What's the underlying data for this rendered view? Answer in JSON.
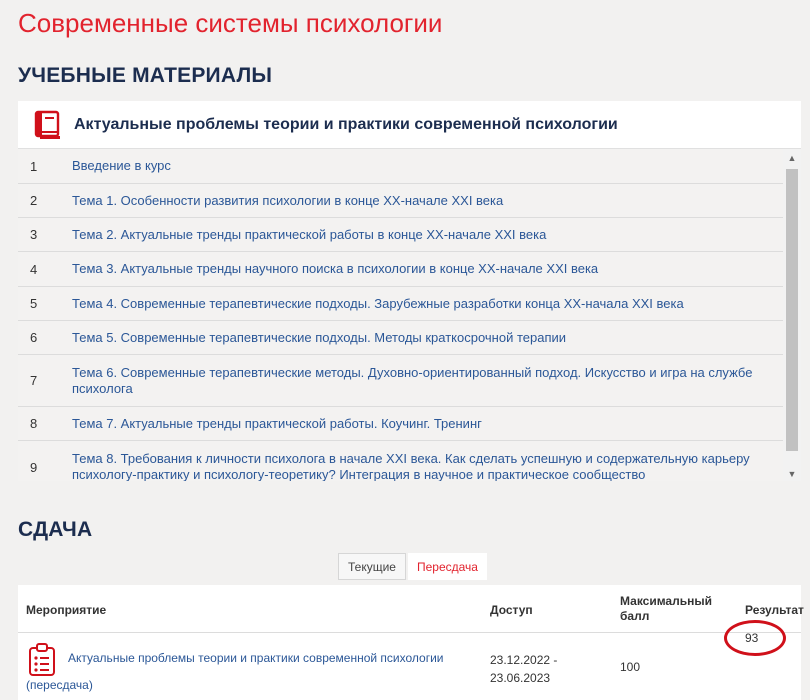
{
  "page": {
    "title": "Современные системы психологии"
  },
  "materials": {
    "heading": "УЧЕБНЫЕ МАТЕРИАЛЫ",
    "course_title": "Актуальные проблемы теории и практики современной психологии",
    "topics": [
      {
        "num": "1",
        "title": "Введение в курс"
      },
      {
        "num": "2",
        "title": "Тема 1. Особенности развития психологии в конце XX-начале XXI века"
      },
      {
        "num": "3",
        "title": "Тема 2. Актуальные тренды практической работы в конце XX-начале XXI века"
      },
      {
        "num": "4",
        "title": "Тема 3. Актуальные тренды научного поиска в психологии в конце XX-начале XXI века"
      },
      {
        "num": "5",
        "title": "Тема 4. Современные терапевтические подходы. Зарубежные разработки конца XX-начала XXI века"
      },
      {
        "num": "6",
        "title": "Тема 5. Современные терапевтические подходы. Методы краткосрочной терапии"
      },
      {
        "num": "7",
        "title": "Тема 6. Современные терапевтические методы. Духовно-ориентированный подход. Искусство и игра на службе психолога"
      },
      {
        "num": "8",
        "title": "Тема 7. Актуальные тренды практической работы. Коучинг. Тренинг"
      },
      {
        "num": "9",
        "title": "Тема 8. Требования к личности психолога в начале XXI века. Как сделать успешную и содержательную карьеру психологу-практику и психологу-теоретику? Интеграция в научное и практическое сообщество"
      }
    ]
  },
  "submission": {
    "heading": "СДАЧА",
    "tabs": {
      "current": "Текущие",
      "retake": "Пересдача"
    },
    "table": {
      "headers": {
        "event": "Мероприятие",
        "access": "Доступ",
        "max_score": "Максимальный балл",
        "result": "Результат"
      },
      "row": {
        "event_title": "Актуальные проблемы теории и практики современной психологии",
        "event_suffix": "(пересдача)",
        "access_from": "23.12.2022 -",
        "access_to": "23.06.2023",
        "max_score": "100",
        "result": "93"
      }
    }
  },
  "colors": {
    "accent_red": "#e2232e",
    "heading_navy": "#1c2d4f",
    "link_blue": "#2b5797",
    "highlight_circle": "#d0101a"
  }
}
